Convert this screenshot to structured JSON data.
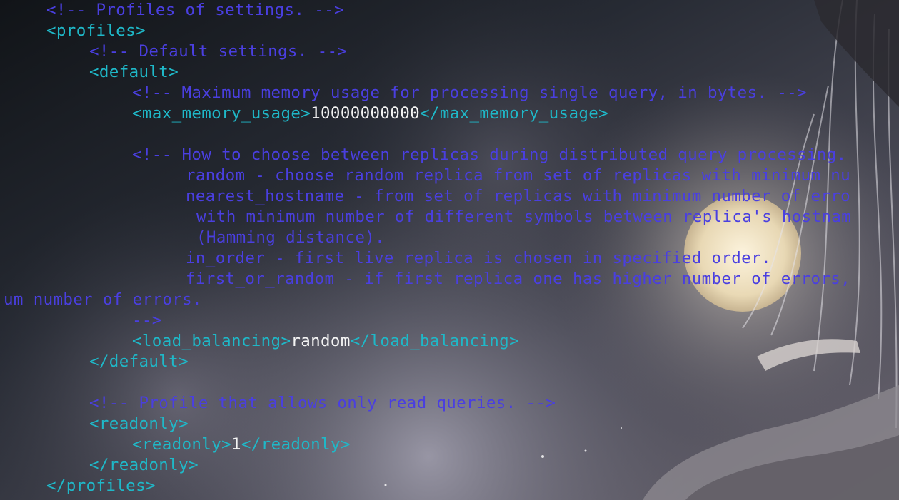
{
  "colors": {
    "tag": "#1fb8c8",
    "comment": "#4a3fe0",
    "value": "#f4f4f4",
    "background": "#1b1f27"
  },
  "lines": {
    "l01": "<!-- Profiles of settings. -->",
    "l02": "<profiles>",
    "l03": "<!-- Default settings. -->",
    "l04": "<default>",
    "l05": "<!-- Maximum memory usage for processing single query, in bytes. -->",
    "l06_open": "<max_memory_usage>",
    "l06_value": "10000000000",
    "l06_close": "</max_memory_usage>",
    "l08": "<!-- How to choose between replicas during distributed query processing.",
    "l09": "random - choose random replica from set of replicas with minimum nu",
    "l10": "nearest_hostname - from set of replicas with minimum number of erro",
    "l11": "with minimum number of different symbols between replica's hostnam",
    "l12": "(Hamming distance).",
    "l13": "in_order - first live replica is chosen in specified order.",
    "l14": "first_or_random - if first replica one has higher number of errors,",
    "l15": "um number of errors.",
    "l16": "-->",
    "l17_open": "<load_balancing>",
    "l17_value": "random",
    "l17_close": "</load_balancing>",
    "l18": "</default>",
    "l20": "<!-- Profile that allows only read queries. -->",
    "l21": "<readonly>",
    "l22_open": "<readonly>",
    "l22_value": "1",
    "l22_close": "</readonly>",
    "l23": "</readonly>",
    "l24": "</profiles>"
  }
}
